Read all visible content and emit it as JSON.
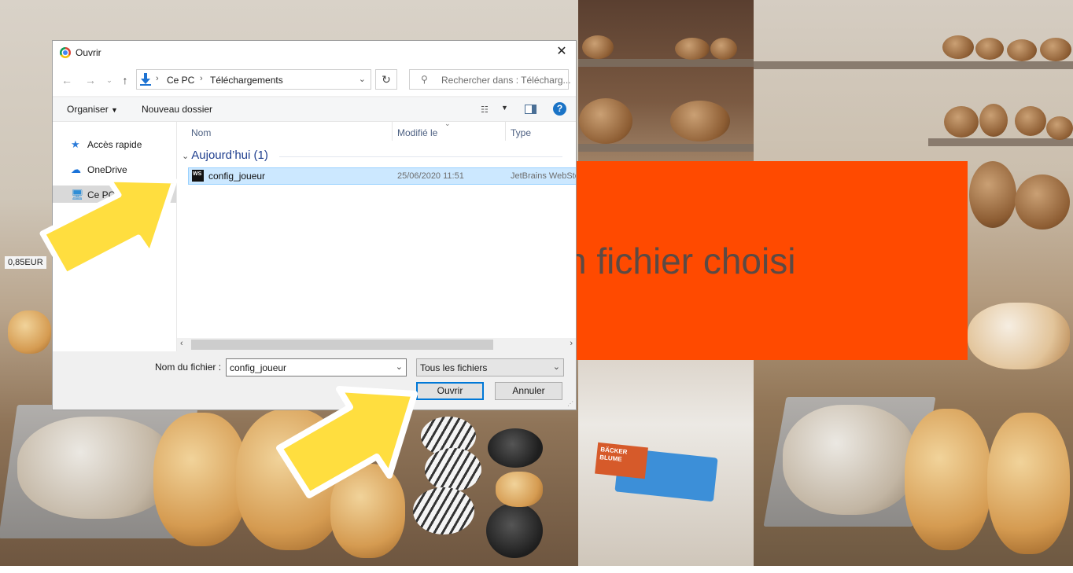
{
  "background": {
    "price_tag": "0,85EUR",
    "overlay_text": "n fichier choisi",
    "overlay_color": "#ff4a00",
    "box_label_1": "BÄCKER",
    "box_label_2": "BLUME"
  },
  "dialog": {
    "title": "Ouvrir",
    "breadcrumb": [
      "Ce PC",
      "Téléchargements"
    ],
    "search_placeholder": "Rechercher dans : Télécharg...",
    "toolbar": {
      "organize": "Organiser",
      "new_folder": "Nouveau dossier"
    },
    "sidebar": {
      "items": [
        {
          "label": "Accès rapide",
          "icon": "star-icon"
        },
        {
          "label": "OneDrive",
          "icon": "cloud-icon"
        },
        {
          "label": "Ce PC",
          "icon": "computer-icon"
        }
      ]
    },
    "columns": {
      "name": "Nom",
      "modified": "Modifié le",
      "type": "Type"
    },
    "group": "Aujourd’hui (1)",
    "files": [
      {
        "icon_label": "WS",
        "name": "config_joueur",
        "modified": "25/06/2020 11:51",
        "type": "JetBrains WebStorm"
      }
    ],
    "filename_label": "Nom du fichier :",
    "filename_value": "config_joueur",
    "filetype_value": "Tous les fichiers",
    "open_label": "Ouvrir",
    "cancel_label": "Annuler"
  },
  "colors": {
    "accent": "#0078d7",
    "selection": "#cce8ff",
    "arrow": "#ffde3f"
  }
}
